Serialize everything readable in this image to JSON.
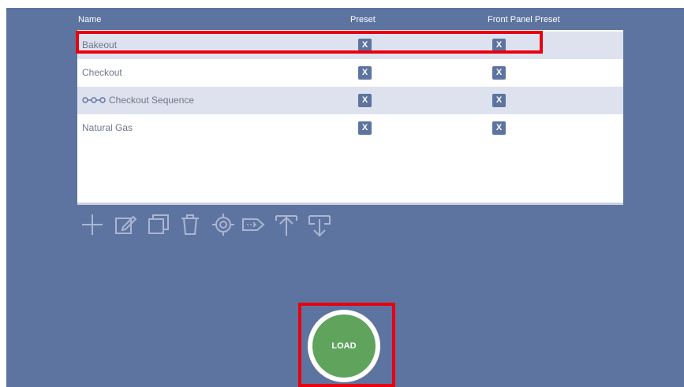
{
  "table": {
    "headers": {
      "name": "Name",
      "preset": "Preset",
      "front_panel_preset": "Front Panel Preset"
    },
    "rows": [
      {
        "name": "Bakeout",
        "preset_label": "X",
        "fpp_label": "X",
        "selected": true,
        "icon": ""
      },
      {
        "name": "Checkout",
        "preset_label": "X",
        "fpp_label": "X",
        "selected": false,
        "icon": ""
      },
      {
        "name": "Checkout Sequence",
        "preset_label": "X",
        "fpp_label": "X",
        "selected": false,
        "icon": "sequence-icon"
      },
      {
        "name": "Natural Gas",
        "preset_label": "X",
        "fpp_label": "X",
        "selected": false,
        "icon": ""
      }
    ]
  },
  "toolbar": {
    "icons": [
      "add-icon",
      "edit-icon",
      "copy-icon",
      "delete-icon",
      "target-icon",
      "tag-icon",
      "upload-icon",
      "download-icon"
    ]
  },
  "load_button": {
    "label": "LOAD"
  },
  "colors": {
    "panel": "#5e74a0",
    "row_alt": "#dde2ee",
    "load": "#5fa35d",
    "highlight": "#e8000f"
  }
}
